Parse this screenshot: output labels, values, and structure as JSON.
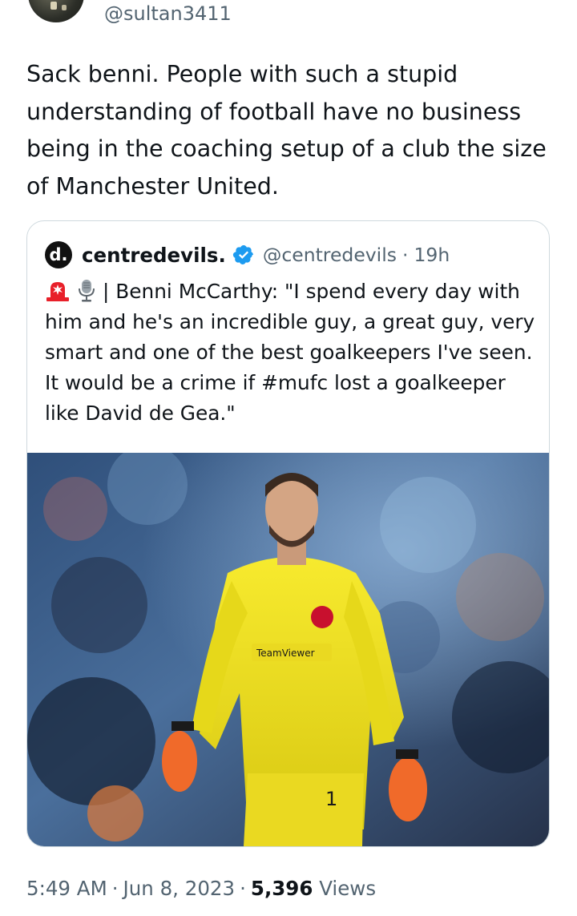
{
  "author": {
    "handle": "@sultan3411"
  },
  "tweet": {
    "text": "Sack benni. People with such a stupid\nunderstanding of football have no business\nbeing in the coaching setup of a club the size\nof Manchester United."
  },
  "quoted": {
    "logo_letter": "d.",
    "name": "centredevils.",
    "handle": "@centredevils",
    "separator": "·",
    "time": "19h",
    "emoji_icons": [
      "siren-icon",
      "microphone-icon"
    ],
    "text": "| Benni McCarthy: \"I spend every day with him and he's an incredible guy, a great guy, very smart and one of the best goalkeepers I've seen. It would be a crime if #mufc lost a goalkeeper like David de Gea.\"",
    "image": {
      "sponsor_text": "TeamViewer",
      "colors": {
        "kit": "#f2e520",
        "gloves": "#f06a2a",
        "crowd": "#3d5a80"
      }
    }
  },
  "footer": {
    "time": "5:49 AM",
    "dot1": "·",
    "date": "Jun 8, 2023",
    "dot2": "·",
    "views_count": "5,396",
    "views_label": "Views"
  },
  "colors": {
    "text_primary": "#0f1419",
    "text_secondary": "#536471",
    "border": "#cfd9de",
    "verified_blue": "#1d9bf0"
  }
}
